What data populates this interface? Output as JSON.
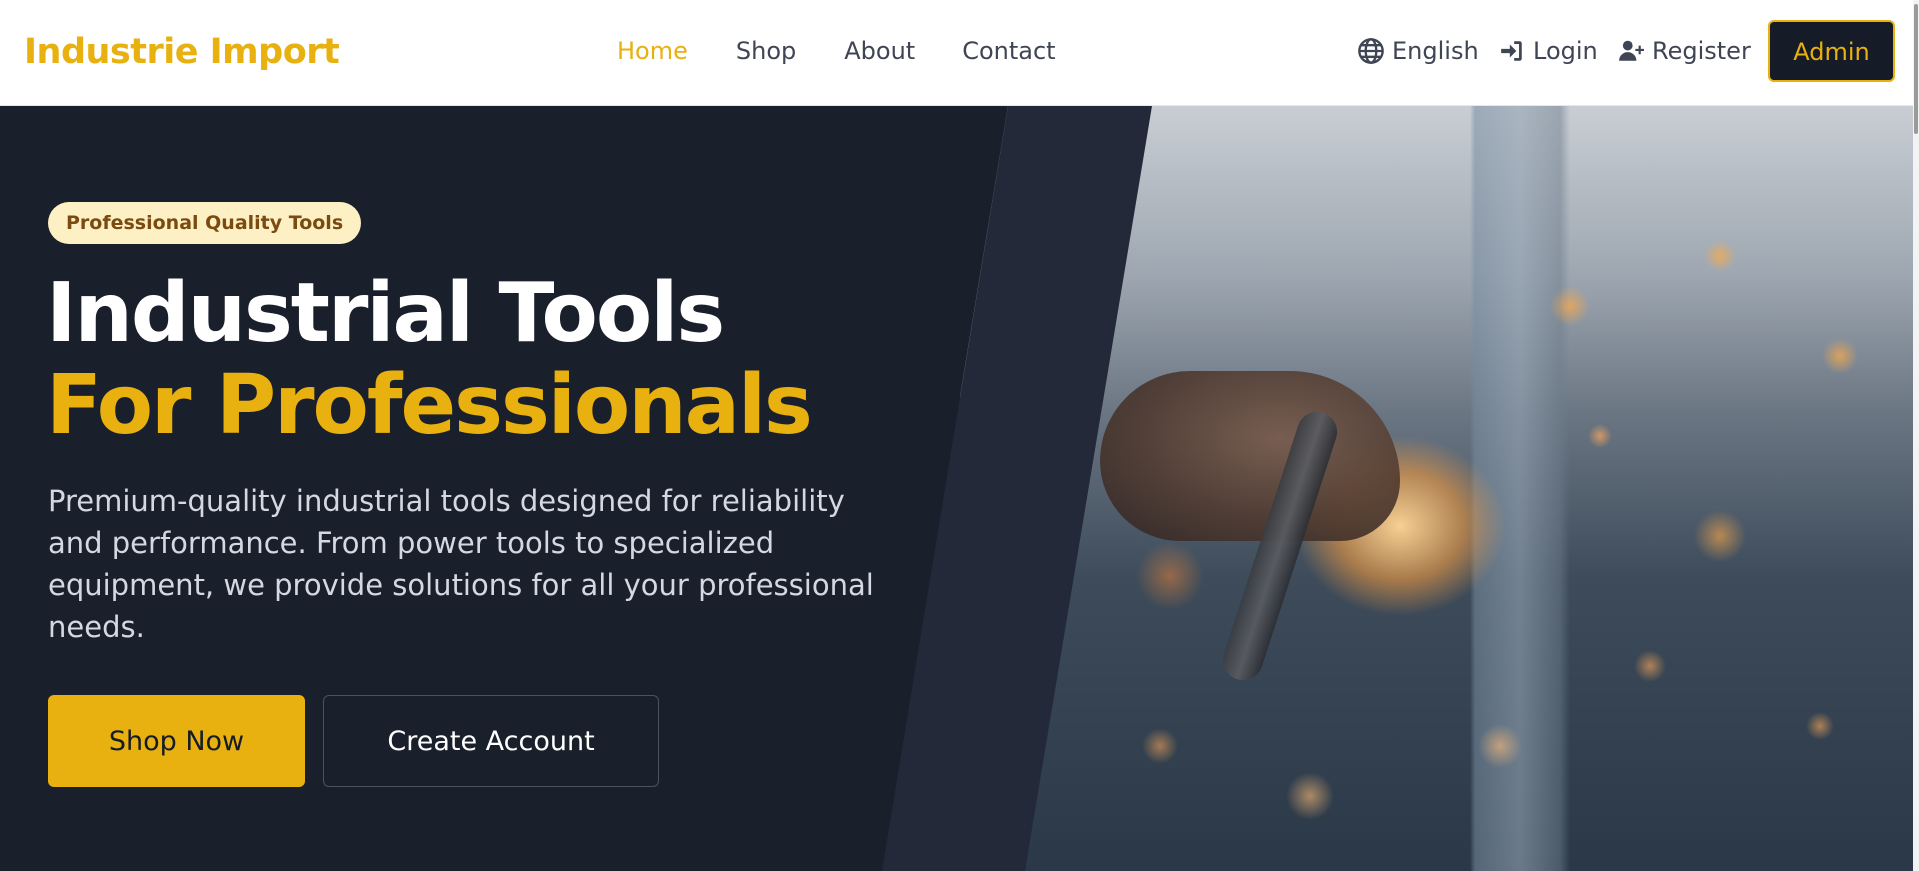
{
  "header": {
    "brand": "Industrie Import",
    "nav": [
      {
        "label": "Home",
        "active": true
      },
      {
        "label": "Shop",
        "active": false
      },
      {
        "label": "About",
        "active": false
      },
      {
        "label": "Contact",
        "active": false
      }
    ],
    "language": {
      "label": "English",
      "icon": "globe-icon"
    },
    "login": {
      "label": "Login",
      "icon": "sign-in-icon"
    },
    "register": {
      "label": "Register",
      "icon": "user-plus-icon"
    },
    "admin": {
      "label": "Admin"
    }
  },
  "hero": {
    "badge": "Professional Quality Tools",
    "title_line1": "Industrial Tools",
    "title_line2": "For Professionals",
    "description": "Premium-quality industrial tools designed for reliability and performance. From power tools to specialized equipment, we provide solutions for all your professional needs.",
    "primary_button": "Shop Now",
    "secondary_button": "Create Account",
    "image": "welding-sparks-photo"
  },
  "colors": {
    "accent": "#e8b10f",
    "dark": "#1a1f2c",
    "nav_text": "#3f4555"
  }
}
